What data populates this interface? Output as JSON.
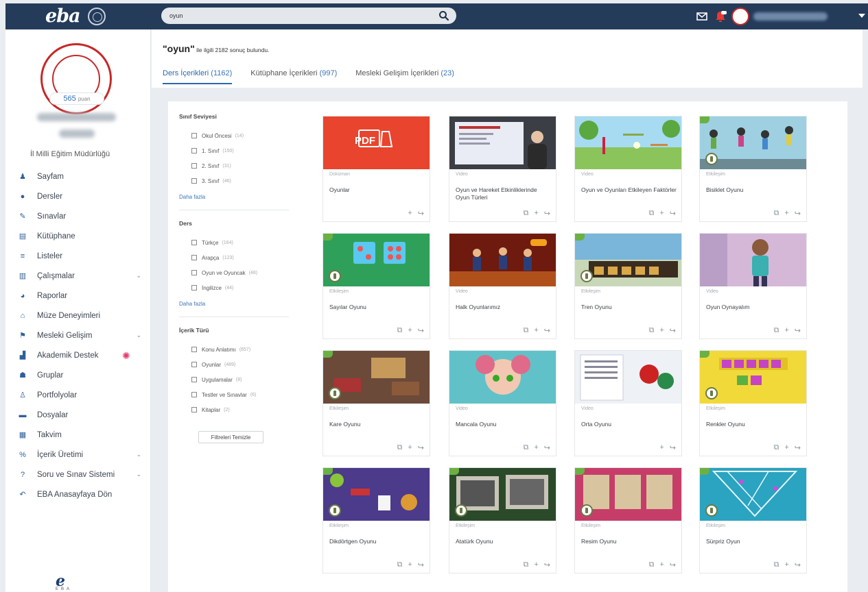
{
  "app": {
    "logo_text": "eba",
    "search_value": "oyun"
  },
  "sidebar": {
    "points_value": "565",
    "points_unit": "puan",
    "directorate": "İl Milli Eğitim Müdürlüğü",
    "items": [
      {
        "label": "Sayfam",
        "icon": "person-icon",
        "glyph": "♟",
        "chevron": false
      },
      {
        "label": "Dersler",
        "icon": "circle-icon",
        "glyph": "●",
        "chevron": false
      },
      {
        "label": "Sınavlar",
        "icon": "pencil-icon",
        "glyph": "✎",
        "chevron": false
      },
      {
        "label": "Kütüphane",
        "icon": "library-icon",
        "glyph": "▤",
        "chevron": false
      },
      {
        "label": "Listeler",
        "icon": "list-icon",
        "glyph": "≡",
        "chevron": false
      },
      {
        "label": "Çalışmalar",
        "icon": "works-icon",
        "glyph": "▥",
        "chevron": true
      },
      {
        "label": "Raporlar",
        "icon": "report-icon",
        "glyph": "◕",
        "chevron": false
      },
      {
        "label": "Müze Deneyimleri",
        "icon": "museum-icon",
        "glyph": "⌂",
        "chevron": false
      },
      {
        "label": "Mesleki Gelişim",
        "icon": "development-icon",
        "glyph": "⚑",
        "chevron": true
      },
      {
        "label": "Akademik Destek",
        "icon": "academic-icon",
        "glyph": "▟",
        "chevron": false
      },
      {
        "label": "Gruplar",
        "icon": "groups-icon",
        "glyph": "☗",
        "chevron": false
      },
      {
        "label": "Portfolyolar",
        "icon": "portfolio-icon",
        "glyph": "♙",
        "chevron": false
      },
      {
        "label": "Dosyalar",
        "icon": "folder-icon",
        "glyph": "▬",
        "chevron": false
      },
      {
        "label": "Takvim",
        "icon": "calendar-icon",
        "glyph": "▦",
        "chevron": false
      },
      {
        "label": "İçerik Üretimi",
        "icon": "percent-icon",
        "glyph": "%",
        "chevron": true
      },
      {
        "label": "Soru ve Sınav Sistemi",
        "icon": "question-icon",
        "glyph": "?",
        "chevron": true
      },
      {
        "label": "EBA Anasayfaya Dön",
        "icon": "back-icon",
        "glyph": "↶",
        "chevron": false
      }
    ],
    "bottom_logo_mark": "e",
    "bottom_logo_text": "EBA"
  },
  "results": {
    "query": "\"oyun\"",
    "summary": " ile ilgili 2182 sonuç bulundu.",
    "tabs": [
      {
        "label": "Ders İçerikleri",
        "count": "(1162)",
        "active": true
      },
      {
        "label": "Kütüphane İçerikleri",
        "count": "(997)",
        "active": false
      },
      {
        "label": "Mesleki Gelişim İçerikleri",
        "count": "(23)",
        "active": false
      }
    ]
  },
  "filters": {
    "groups": [
      {
        "title": "Sınıf Seviyesi",
        "options": [
          {
            "label": "Okul Öncesi",
            "count": "(14)"
          },
          {
            "label": "1. Sınıf",
            "count": "(150)"
          },
          {
            "label": "2. Sınıf",
            "count": "(31)"
          },
          {
            "label": "3. Sınıf",
            "count": "(46)"
          }
        ],
        "more": "Daha fazla"
      },
      {
        "title": "Ders",
        "options": [
          {
            "label": "Türkçe",
            "count": "(164)"
          },
          {
            "label": "Arapça",
            "count": "(123)"
          },
          {
            "label": "Oyun ve Oyuncak",
            "count": "(48)"
          },
          {
            "label": "İngilizce",
            "count": "(44)"
          }
        ],
        "more": "Daha fazla"
      },
      {
        "title": "İçerik Türü",
        "options": [
          {
            "label": "Konu Anlatımı",
            "count": "(657)"
          },
          {
            "label": "Oyunlar",
            "count": "(489)"
          },
          {
            "label": "Uygulamalar",
            "count": "(8)"
          },
          {
            "label": "Testler ve Sınavlar",
            "count": "(6)"
          },
          {
            "label": "Kitaplar",
            "count": "(2)"
          }
        ],
        "more": ""
      }
    ],
    "clear_label": "Filtreleri Temizle"
  },
  "cards": [
    {
      "type": "Doküman",
      "title": "Oyunlar",
      "thumb": "pdf",
      "save": false
    },
    {
      "type": "Video",
      "title": "Oyun ve Hareket Etkinliklerinde Oyun Türleri",
      "thumb": "teacher",
      "save": true
    },
    {
      "type": "Video",
      "title": "Oyun ve Oyunları Etkileyen Faktörler",
      "thumb": "playground",
      "save": true
    },
    {
      "type": "Etkileşim",
      "title": "Bisiklet Oyunu",
      "thumb": "kids",
      "save": true
    },
    {
      "type": "Etkileşim",
      "title": "Sayılar Oyunu",
      "thumb": "dice",
      "save": true
    },
    {
      "type": "Video",
      "title": "Halk Oyunlarımız",
      "thumb": "folk",
      "save": true
    },
    {
      "type": "Etkileşim",
      "title": "Tren Oyunu",
      "thumb": "train",
      "save": true
    },
    {
      "type": "Video",
      "title": "Oyun Oynayalım",
      "thumb": "boy",
      "save": true
    },
    {
      "type": "Etkileşim",
      "title": "Kare Oyunu",
      "thumb": "room",
      "save": true
    },
    {
      "type": "Video",
      "title": "Mancala Oyunu",
      "thumb": "girl",
      "save": true
    },
    {
      "type": "Video",
      "title": "Orta Oyunu",
      "thumb": "book",
      "save": false
    },
    {
      "type": "Etkileşim",
      "title": "Renkler Oyunu",
      "thumb": "colors",
      "save": true
    },
    {
      "type": "Etkileşim",
      "title": "Dikdörtgen Oyunu",
      "thumb": "toys",
      "save": true
    },
    {
      "type": "Etkileşim",
      "title": "Atatürk Oyunu",
      "thumb": "photos",
      "save": true
    },
    {
      "type": "Etkileşim",
      "title": "Resim Oyunu",
      "thumb": "frames",
      "save": true
    },
    {
      "type": "Etkileşim",
      "title": "Sürpriz Oyun",
      "thumb": "tangram",
      "save": true
    }
  ],
  "icons": {
    "search": "search-icon",
    "mail": "mail-icon",
    "notifications": "notification-icon",
    "caret": "caret-down-icon",
    "save": "save-icon",
    "add": "plus-icon",
    "share": "share-icon"
  },
  "colors": {
    "topbar": "#243b5a",
    "accent": "#2a69ad",
    "seal": "#c62828"
  }
}
